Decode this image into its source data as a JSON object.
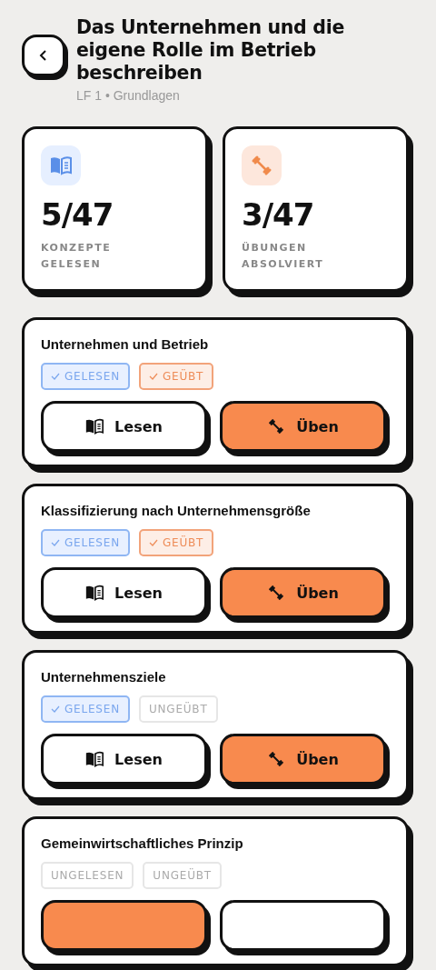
{
  "header": {
    "title": "Das Unternehmen und die eigene Rolle im Betrieb beschreiben",
    "subtitle": "LF 1 • Grundlagen"
  },
  "stats": [
    {
      "kind": "read",
      "value": "5/47",
      "label": "KONZEPTE GELESEN"
    },
    {
      "kind": "practice",
      "value": "3/47",
      "label": "ÜBUNGEN ABSOLVIERT"
    }
  ],
  "topics": [
    {
      "title": "Unternehmen und Betrieb",
      "tags": [
        {
          "kind": "read",
          "label": "GELESEN",
          "checked": true
        },
        {
          "kind": "practice",
          "label": "GEÜBT",
          "checked": true
        }
      ],
      "buttons": [
        {
          "kind": "read",
          "label": "Lesen",
          "primary": false
        },
        {
          "kind": "practice",
          "label": "Üben",
          "primary": true
        }
      ]
    },
    {
      "title": "Klassifizierung nach Unternehmensgröße",
      "tags": [
        {
          "kind": "read",
          "label": "GELESEN",
          "checked": true
        },
        {
          "kind": "practice",
          "label": "GEÜBT",
          "checked": true
        }
      ],
      "buttons": [
        {
          "kind": "read",
          "label": "Lesen",
          "primary": false
        },
        {
          "kind": "practice",
          "label": "Üben",
          "primary": true
        }
      ]
    },
    {
      "title": "Unternehmensziele",
      "tags": [
        {
          "kind": "read",
          "label": "GELESEN",
          "checked": true
        },
        {
          "kind": "practice",
          "label": "UNGEÜBT",
          "checked": false
        }
      ],
      "buttons": [
        {
          "kind": "read",
          "label": "Lesen",
          "primary": false
        },
        {
          "kind": "practice",
          "label": "Üben",
          "primary": true
        }
      ]
    },
    {
      "title": "Gemeinwirtschaftliches Prinzip",
      "tags": [
        {
          "kind": "read",
          "label": "UNGELESEN",
          "checked": false
        },
        {
          "kind": "practice",
          "label": "UNGEÜBT",
          "checked": false
        }
      ],
      "buttons": [
        {
          "kind": "read",
          "primary": true
        },
        {
          "kind": "practice",
          "primary": false
        }
      ]
    }
  ]
}
